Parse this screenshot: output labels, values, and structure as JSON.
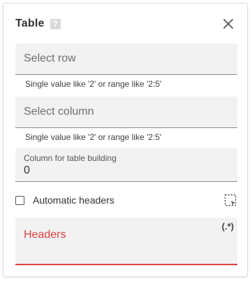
{
  "dialog": {
    "title": "Table",
    "help_icon": "?",
    "close_icon": "close-icon"
  },
  "select_row": {
    "placeholder": "Select row",
    "hint": "Single value like '2' or range like '2:5'"
  },
  "select_column": {
    "placeholder": "Select column",
    "hint": "Single value like '2' or range like '2:5'"
  },
  "column_for_table_building": {
    "label": "Column for table building",
    "value": "0"
  },
  "automatic_headers": {
    "label": "Automatic headers",
    "checked": false,
    "select_area_icon": "select-area-icon"
  },
  "headers": {
    "label": "Headers",
    "regex_toggle": "(.*)",
    "error_color": "#e04040"
  }
}
